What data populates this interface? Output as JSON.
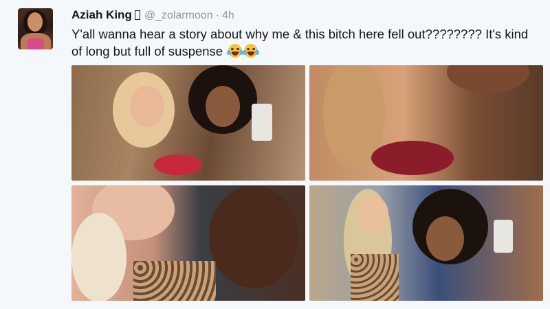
{
  "tweet": {
    "author_name": "Aziah King",
    "verified_glyph": "",
    "handle": "@_zolarmoon",
    "separator": "·",
    "time": "4h",
    "text": "Y'all wanna hear a story about why me & this bitch here fell out???????? It's kind of long but full of suspense",
    "emojis": [
      "face-with-tears-of-joy-icon",
      "loudly-crying-face-icon"
    ],
    "photos": [
      {
        "name": "photo-1",
        "description_icon": "selfie-two-women-mirror"
      },
      {
        "name": "photo-2",
        "description_icon": "selfie-two-women-closeup"
      },
      {
        "name": "photo-3",
        "description_icon": "selfie-two-women-leopard"
      },
      {
        "name": "photo-4",
        "description_icon": "selfie-two-women-locker"
      }
    ]
  },
  "colors": {
    "background": "#f5f8fa",
    "text": "#14171a",
    "muted": "#8899a6"
  }
}
